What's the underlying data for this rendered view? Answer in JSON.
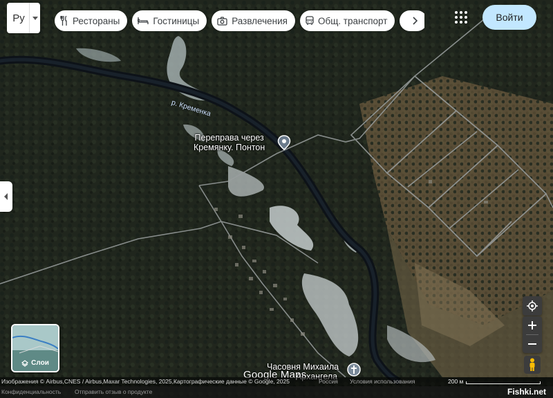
{
  "language": {
    "label": "Ру"
  },
  "chips": [
    {
      "label": "Рестораны",
      "icon": "fork-knife-icon"
    },
    {
      "label": "Гостиницы",
      "icon": "bed-icon"
    },
    {
      "label": "Развлечения",
      "icon": "camera-icon"
    },
    {
      "label": "Общ. транспорт",
      "icon": "bus-icon"
    }
  ],
  "header": {
    "signin_label": "Войти"
  },
  "map": {
    "river_label": "р. Кременка",
    "places": [
      {
        "name_line1": "Переправа через",
        "name_line2": "Кремянку. Понтон",
        "icon": "location-pin-icon"
      },
      {
        "name_line1": "Часовня Михаила",
        "name_line2": "Архангела",
        "icon": "cross-pin-icon"
      }
    ],
    "google_logo": "Google Maps",
    "layers_label": "Слои"
  },
  "footer": {
    "attribution": "Изображения © Airbus,CNES / Airbus,Maxar Technologies, 2025,Картографические данные © Google, 2025",
    "country": "Россия",
    "terms": "Условия использования",
    "privacy": "Конфиденциальность",
    "feedback": "Отправить отзыв о продукте",
    "scale": "200 м",
    "watermark": "Fishki.net"
  }
}
